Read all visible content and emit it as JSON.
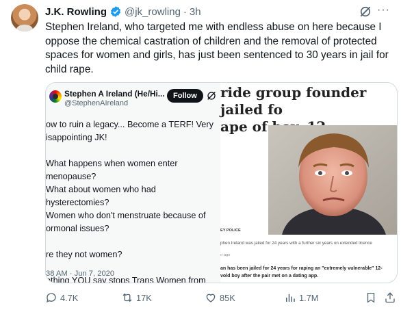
{
  "post": {
    "author_name": "J.K. Rowling",
    "author_handle": "@jk_rowling",
    "separator": "·",
    "time": "3h",
    "more": "···",
    "text": "Stephen Ireland, who targeted me with endless abuse on here because I oppose the chemical castration of children and the removal of protected spaces for women and girls, has just been sentenced to 30 years in jail for child rape."
  },
  "quoted_tweet": {
    "author_name": "Stephen A Ireland (He/Hi...",
    "author_handle": "@StephenAIreland",
    "follow_label": "Follow",
    "text": "ow to ruin a legacy... Become a TERF! Very\nisappointing JK!\n\nWhat happens when women enter menopause?\nWhat about women who had hysterectomies?\nWomen who don't menstruate because of\normonal issues?\n\nre they not women?\n\nothing YOU say stops Trans Women from\neing Women.",
    "timestamp": "38 AM · Jun 7, 2020"
  },
  "news_article": {
    "headline": "ride group founder jailed fo\nape of boy, 12",
    "photo_credit": "ЕY POLICE",
    "caption": "phen Ireland was jailed for 24 years with a further six years on extended licence",
    "age": "ır ago",
    "body": "an has been jailed for 24 years for raping an \"extremely vulnerable\" 12-\nvold boy after the pair met on a dating app."
  },
  "actions": {
    "replies": "4.7K",
    "reposts": "17K",
    "likes": "85K",
    "views": "1.7M"
  },
  "icons": {
    "verified": "verified-badge-icon",
    "grok": "grok-icon",
    "reply": "reply-icon",
    "repost": "repost-icon",
    "like": "heart-icon",
    "views": "views-chart-icon",
    "bookmark": "bookmark-icon",
    "share": "share-icon"
  },
  "colors": {
    "verified_blue": "#1d9bf0",
    "text": "#0f1419",
    "muted": "#536471"
  }
}
